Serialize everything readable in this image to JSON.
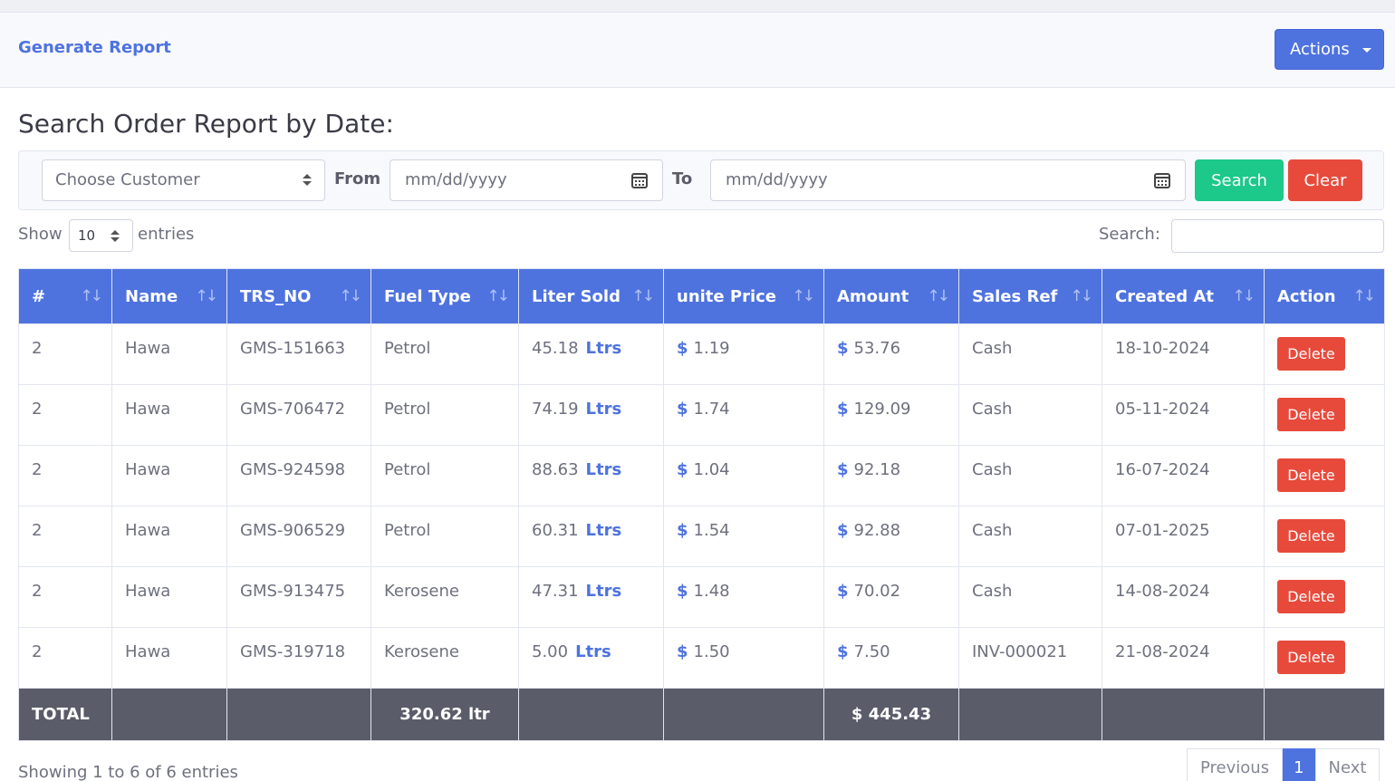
{
  "header": {
    "title": "Generate Report",
    "actions_label": "Actions"
  },
  "section_title": "Search Order Report by Date:",
  "filter": {
    "customer_placeholder": "Choose Customer",
    "from_label": "From",
    "to_label": "To",
    "from_placeholder": "mm/dd/yyyy",
    "to_placeholder": "mm/dd/yyyy",
    "search_label": "Search",
    "clear_label": "Clear"
  },
  "length": {
    "show": "Show",
    "value": "10",
    "entries": "entries"
  },
  "search": {
    "label": "Search:",
    "value": ""
  },
  "table": {
    "columns": [
      "#",
      "Name",
      "TRS_NO",
      "Fuel Type",
      "Liter Sold",
      "unite Price",
      "Amount",
      "Sales Ref",
      "Created At",
      "Action"
    ],
    "unit_label": "Ltrs",
    "currency": "$",
    "delete_label": "Delete",
    "rows": [
      {
        "num": "2",
        "name": "Hawa",
        "trs": "GMS-151663",
        "fuel": "Petrol",
        "liters": "45.18",
        "price": "1.19",
        "amount": "53.76",
        "ref": "Cash",
        "date": "18-10-2024"
      },
      {
        "num": "2",
        "name": "Hawa",
        "trs": "GMS-706472",
        "fuel": "Petrol",
        "liters": "74.19",
        "price": "1.74",
        "amount": "129.09",
        "ref": "Cash",
        "date": "05-11-2024"
      },
      {
        "num": "2",
        "name": "Hawa",
        "trs": "GMS-924598",
        "fuel": "Petrol",
        "liters": "88.63",
        "price": "1.04",
        "amount": "92.18",
        "ref": "Cash",
        "date": "16-07-2024"
      },
      {
        "num": "2",
        "name": "Hawa",
        "trs": "GMS-906529",
        "fuel": "Petrol",
        "liters": "60.31",
        "price": "1.54",
        "amount": "92.88",
        "ref": "Cash",
        "date": "07-01-2025"
      },
      {
        "num": "2",
        "name": "Hawa",
        "trs": "GMS-913475",
        "fuel": "Kerosene",
        "liters": "47.31",
        "price": "1.48",
        "amount": "70.02",
        "ref": "Cash",
        "date": "14-08-2024"
      },
      {
        "num": "2",
        "name": "Hawa",
        "trs": "GMS-319718",
        "fuel": "Kerosene",
        "liters": "5.00",
        "price": "1.50",
        "amount": "7.50",
        "ref": "INV-000021",
        "date": "21-08-2024"
      }
    ],
    "total": {
      "label": "TOTAL",
      "liters": "320.62 ltr",
      "amount": "$ 445.43"
    }
  },
  "footer": {
    "info": "Showing 1 to 6 of 6 entries",
    "previous": "Previous",
    "page": "1",
    "next": "Next"
  },
  "colors": {
    "primary": "#4e73df",
    "success": "#1cc88a",
    "danger": "#e74a3b",
    "total_bg": "#5a5c69"
  }
}
